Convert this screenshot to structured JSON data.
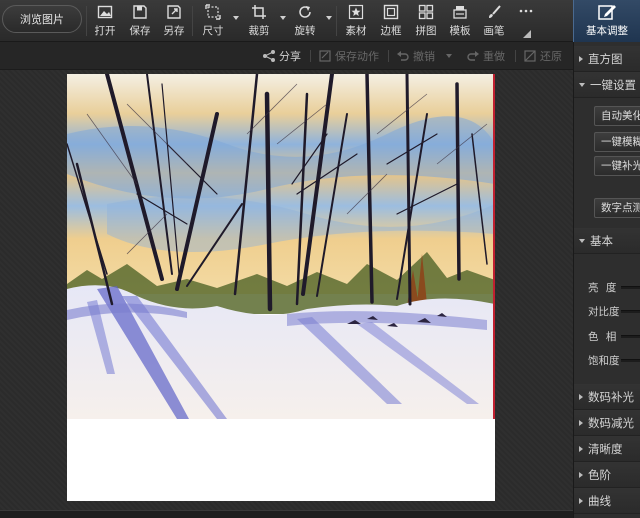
{
  "toolbar": {
    "browse_label": "浏览图片",
    "tools": [
      {
        "id": "open",
        "label": "打开",
        "icon": "open-image-icon"
      },
      {
        "id": "save",
        "label": "保存",
        "icon": "save-icon"
      },
      {
        "id": "save_as",
        "label": "另存",
        "icon": "save-as-icon"
      },
      {
        "id": "size",
        "label": "尺寸",
        "icon": "resize-icon"
      },
      {
        "id": "crop",
        "label": "裁剪",
        "icon": "crop-icon"
      },
      {
        "id": "rotate",
        "label": "旋转",
        "icon": "rotate-icon"
      },
      {
        "id": "material",
        "label": "素材",
        "icon": "star-icon"
      },
      {
        "id": "border",
        "label": "边框",
        "icon": "border-icon"
      },
      {
        "id": "collage",
        "label": "拼图",
        "icon": "grid-icon"
      },
      {
        "id": "template",
        "label": "模板",
        "icon": "template-icon"
      },
      {
        "id": "brush",
        "label": "画笔",
        "icon": "brush-icon"
      }
    ],
    "more_icon": "more-dots-icon",
    "active_tab": {
      "label": "基本调整",
      "icon": "edit-icon"
    }
  },
  "actionbar": {
    "share": "分享",
    "save_action": "保存动作",
    "undo": "撤销",
    "redo": "重做",
    "restore": "还原"
  },
  "panel": {
    "histogram": "直方图",
    "one_click": "一键设置",
    "auto_beautify": "自动美化",
    "one_click_blur": "一键模糊",
    "one_click_fill": "一键补光",
    "digital_exposure": "数字点测光",
    "basic": "基本",
    "brightness": "亮 度",
    "contrast": "对比度",
    "hue": "色 相",
    "saturation": "饱和度",
    "fill_light": "数码补光",
    "reduce_light": "数码减光",
    "sharpness": "清晰度",
    "levels": "色阶",
    "curves": "曲线"
  },
  "colors": {
    "accent_tab": "#2a4262",
    "panel_bg": "#2e2e2e",
    "toolbar_bg": "#333333",
    "sky_blue": "#7fa8d8",
    "sky_gold": "#e7c27e",
    "snow_shadow": "#6a6fd0"
  }
}
